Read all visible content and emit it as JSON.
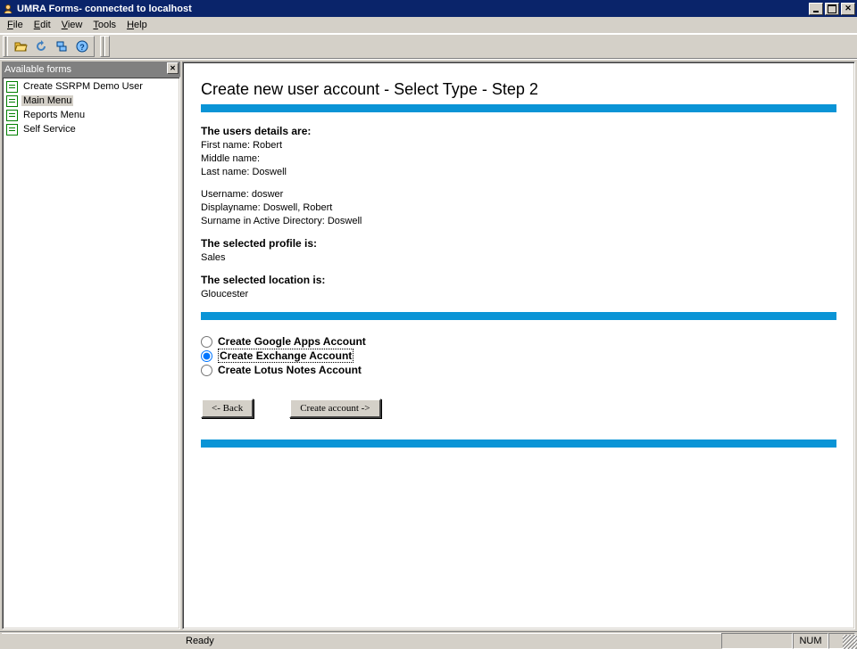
{
  "window": {
    "title": "UMRA Forms- connected to localhost"
  },
  "menu": {
    "file": "File",
    "edit": "Edit",
    "view": "View",
    "tools": "Tools",
    "help": "Help"
  },
  "sidebar": {
    "title": "Available forms",
    "items": [
      {
        "label": "Create SSRPM Demo User"
      },
      {
        "label": "Main Menu"
      },
      {
        "label": "Reports Menu"
      },
      {
        "label": "Self Service"
      }
    ]
  },
  "content": {
    "heading": "Create new user account - Select Type - Step 2",
    "section_user_details": "The users details are:",
    "first_name_label": "First name:",
    "first_name_value": "Robert",
    "middle_name_label": "Middle name:",
    "middle_name_value": "",
    "last_name_label": "Last name:",
    "last_name_value": "Doswell",
    "username_label": "Username:",
    "username_value": "doswer",
    "displayname_label": "Displayname:",
    "displayname_value": "Doswell, Robert",
    "surname_ad_label": "Surname in Active Directory:",
    "surname_ad_value": "Doswell",
    "section_profile": "The selected profile is:",
    "profile_value": "Sales",
    "section_location": "The selected location is:",
    "location_value": "Gloucester",
    "radios": [
      {
        "label": "Create Google Apps Account",
        "checked": false
      },
      {
        "label": "Create Exchange Account",
        "checked": true
      },
      {
        "label": "Create Lotus Notes Account",
        "checked": false
      }
    ],
    "back_button": "<- Back",
    "create_button": "Create account ->"
  },
  "statusbar": {
    "ready": "Ready",
    "num": "NUM"
  }
}
